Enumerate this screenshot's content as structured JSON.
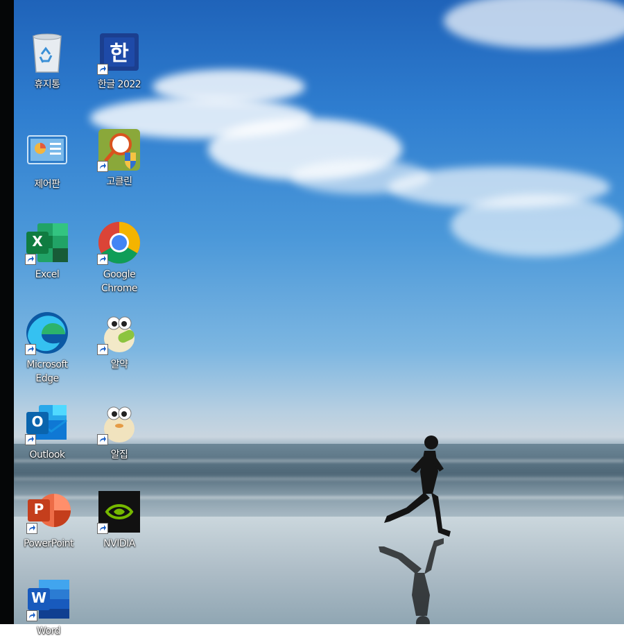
{
  "desktop": {
    "icons": [
      {
        "label": "휴지통",
        "icon": "recycle-bin-icon"
      },
      {
        "label": "한글 2022",
        "icon": "hangul-icon"
      },
      {
        "label": "제어판",
        "icon": "control-panel-icon"
      },
      {
        "label": "고클린",
        "icon": "goclean-icon"
      },
      {
        "label": "Excel",
        "icon": "excel-icon"
      },
      {
        "label": "Google Chrome",
        "icon": "chrome-icon"
      },
      {
        "label": "Microsoft Edge",
        "icon": "edge-icon"
      },
      {
        "label": "알약",
        "icon": "alyac-icon"
      },
      {
        "label": "Outlook",
        "icon": "outlook-icon"
      },
      {
        "label": "알집",
        "icon": "alzip-icon"
      },
      {
        "label": "PowerPoint",
        "icon": "powerpoint-icon"
      },
      {
        "label": "NVIDIA",
        "icon": "nvidia-icon"
      },
      {
        "label": "Word",
        "icon": "word-icon"
      }
    ],
    "glyphs": {
      "hangul": "한",
      "excel": "X",
      "outlook": "O",
      "powerpoint": "P",
      "word": "W"
    },
    "colors": {
      "excel": "#1d6f42",
      "word": "#2b579a",
      "powerpoint": "#d24726",
      "outlook": "#0f6cbd",
      "nvidia": "#76b900"
    }
  }
}
